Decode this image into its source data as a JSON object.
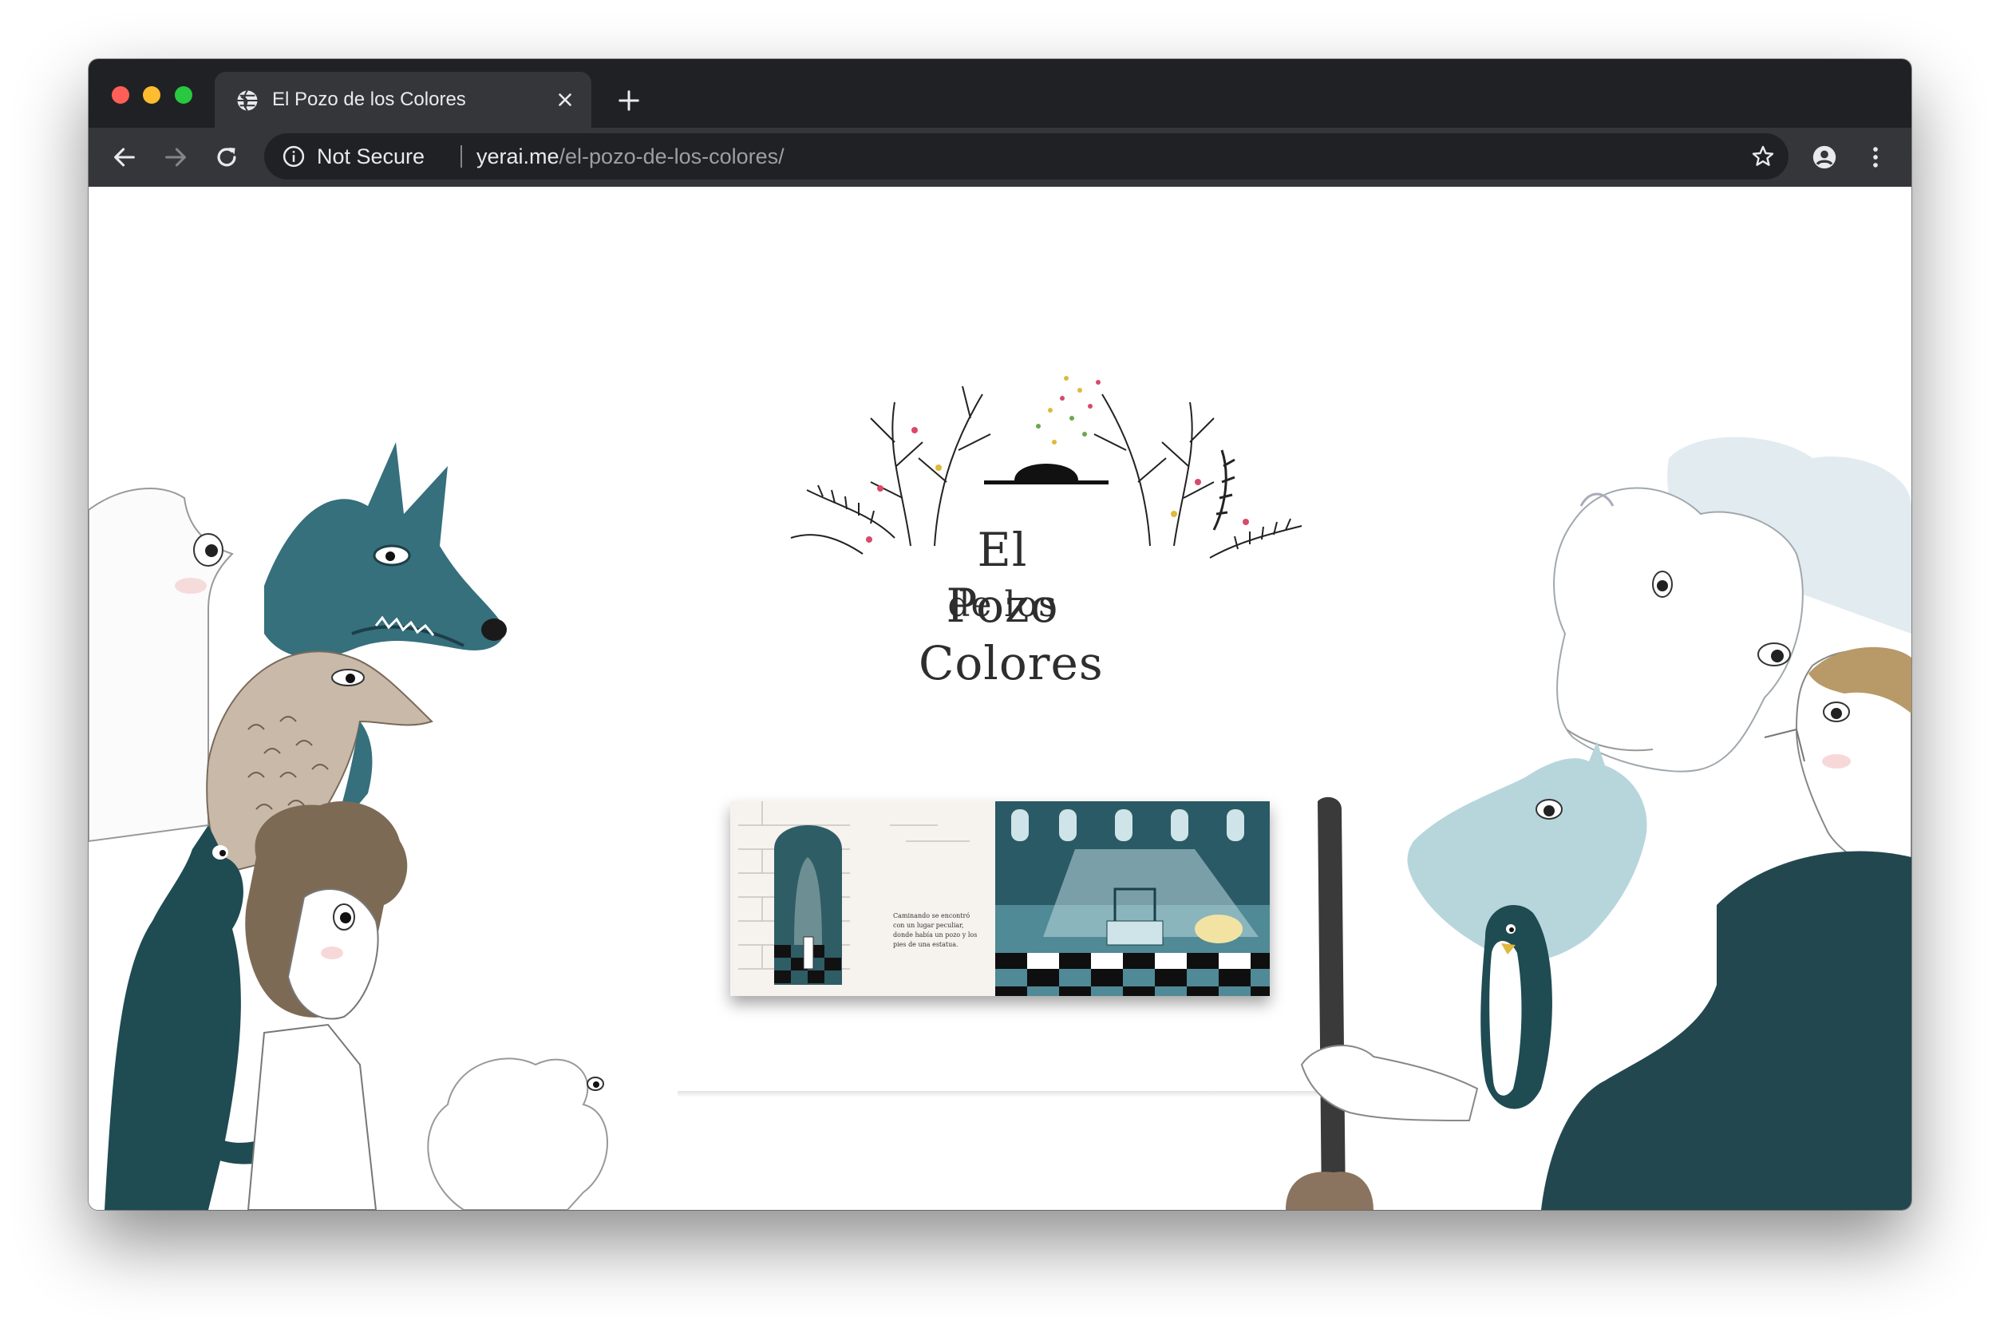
{
  "browser": {
    "tab": {
      "title": "El Pozo de los Colores"
    },
    "address_bar": {
      "security_label": "Not Secure",
      "url_host": "yerai.me",
      "url_path": "/el-pozo-de-los-colores/"
    },
    "icons": {
      "favicon": "globe-icon",
      "tab_close": "close-icon",
      "new_tab": "plus-icon",
      "back": "arrow-left-icon",
      "forward": "arrow-right-icon",
      "reload": "reload-icon",
      "info": "info-icon",
      "bookmark": "star-icon",
      "profile": "account-icon",
      "menu": "kebab-menu-icon"
    }
  },
  "page": {
    "logo": {
      "line1": "El Pozo",
      "line2": "de los",
      "line3": "Colores"
    },
    "book_preview": {
      "left_page_text": "Caminando se encontró con un lugar peculiar, donde había un pozo y los pies de una estatua."
    }
  },
  "colors": {
    "tabstrip": "#202124",
    "toolbar": "#35363a",
    "teal_watercolor": "#2f6e78",
    "page_background": "#ffffff"
  }
}
